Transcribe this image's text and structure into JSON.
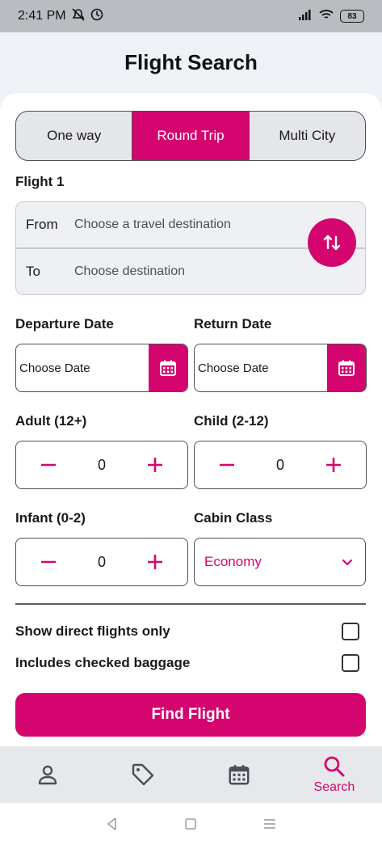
{
  "status_bar": {
    "time": "2:41 PM",
    "battery": "83"
  },
  "header": {
    "title": "Flight Search"
  },
  "trip_type": {
    "options": [
      "One way",
      "Round Trip",
      "Multi City"
    ],
    "selected": "Round Trip"
  },
  "flight1": {
    "label": "Flight 1",
    "from_label": "From",
    "from_placeholder": "Choose a travel destination",
    "to_label": "To",
    "to_placeholder": "Choose destination"
  },
  "dates": {
    "departure_label": "Departure Date",
    "departure_value": "Choose Date",
    "return_label": "Return Date",
    "return_value": "Choose Date"
  },
  "passengers": {
    "adult_label": "Adult (12+)",
    "adult_value": "0",
    "child_label": "Child (2-12)",
    "child_value": "0",
    "infant_label": "Infant (0-2)",
    "infant_value": "0"
  },
  "cabin": {
    "label": "Cabin Class",
    "value": "Economy"
  },
  "options": {
    "direct_label": "Show direct flights only",
    "baggage_label": "Includes checked baggage"
  },
  "find_button": "Find Flight",
  "tabbar": {
    "active_label": "Search"
  },
  "colors": {
    "accent": "#d5056f",
    "border": "#4a4f58"
  }
}
